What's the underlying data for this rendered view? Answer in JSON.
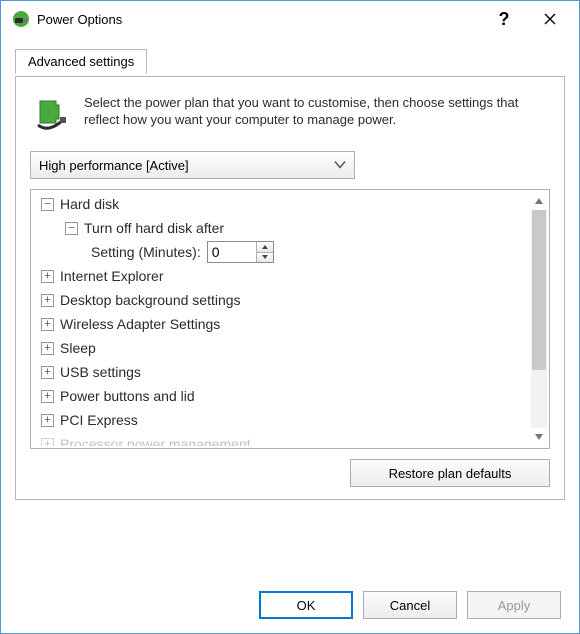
{
  "window": {
    "title": "Power Options"
  },
  "tab": {
    "label": "Advanced settings"
  },
  "intro": {
    "text": "Select the power plan that you want to customise, then choose settings that reflect how you want your computer to manage power."
  },
  "plan": {
    "selected": "High performance [Active]"
  },
  "tree": {
    "hard_disk": {
      "label": "Hard disk"
    },
    "turn_off": {
      "label": "Turn off hard disk after"
    },
    "setting": {
      "label": "Setting (Minutes):",
      "value": "0"
    },
    "ie": {
      "label": "Internet Explorer"
    },
    "desktop_bg": {
      "label": "Desktop background settings"
    },
    "wireless": {
      "label": "Wireless Adapter Settings"
    },
    "sleep": {
      "label": "Sleep"
    },
    "usb": {
      "label": "USB settings"
    },
    "power_buttons": {
      "label": "Power buttons and lid"
    },
    "pci": {
      "label": "PCI Express"
    },
    "processor": {
      "label": "Processor power management"
    }
  },
  "buttons": {
    "restore": "Restore plan defaults",
    "ok": "OK",
    "cancel": "Cancel",
    "apply": "Apply"
  }
}
